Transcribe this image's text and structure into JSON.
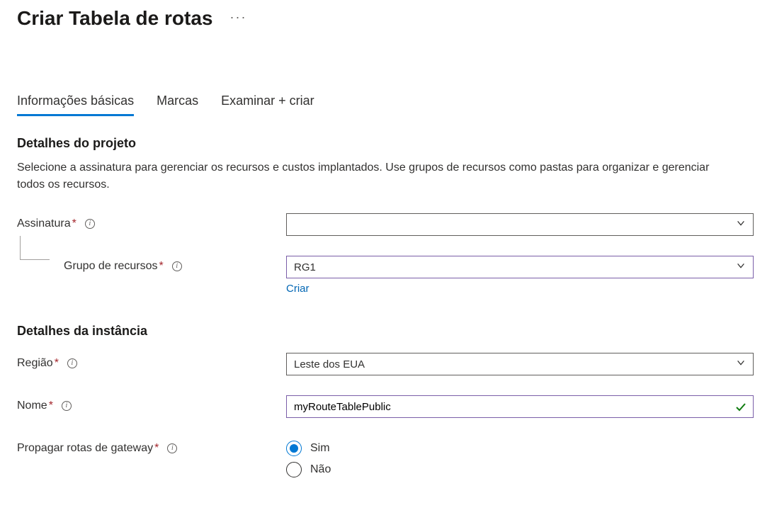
{
  "page": {
    "title": "Criar Tabela de rotas"
  },
  "tabs": {
    "basics": "Informações básicas",
    "tags": "Marcas",
    "review": "Examinar + criar"
  },
  "project": {
    "heading": "Detalhes do projeto",
    "description": "Selecione a assinatura para gerenciar os recursos e custos implantados. Use grupos de recursos como pastas para organizar e gerenciar todos os recursos.",
    "subscription_label": "Assinatura",
    "subscription_value": "",
    "resource_group_label": "Grupo de recursos",
    "resource_group_value": "RG1",
    "create_link": "Criar"
  },
  "instance": {
    "heading": "Detalhes da instância",
    "region_label": "Região",
    "region_value": "Leste dos EUA",
    "name_label": "Nome",
    "name_value": "myRouteTablePublic",
    "propagate_label": "Propagar rotas de gateway",
    "propagate_yes": "Sim",
    "propagate_no": "Não"
  }
}
